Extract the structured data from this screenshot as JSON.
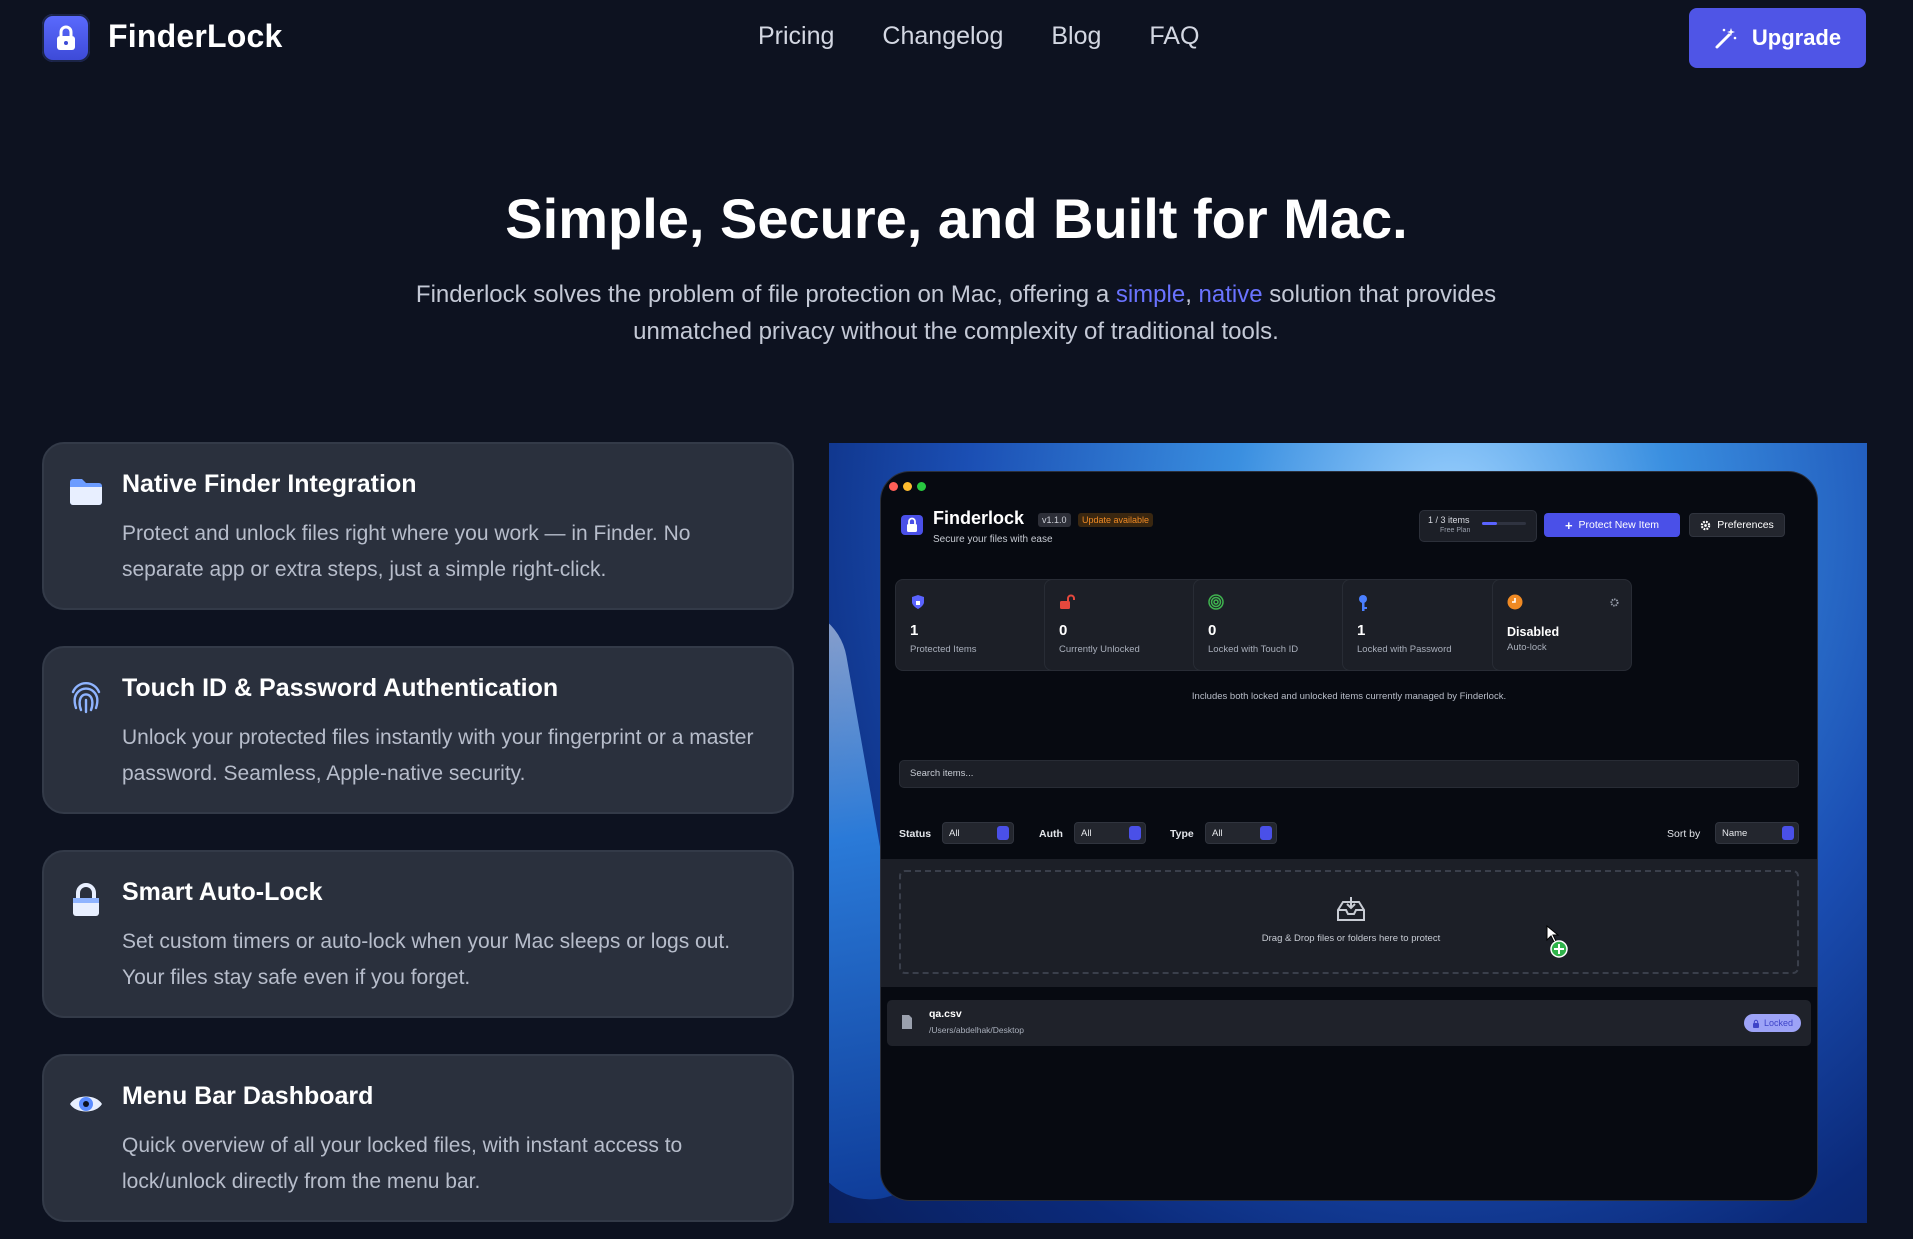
{
  "nav": {
    "brand": "FinderLock",
    "links": [
      "Pricing",
      "Changelog",
      "Blog",
      "FAQ"
    ],
    "upgrade_label": "Upgrade"
  },
  "hero": {
    "title": "Simple, Secure, and Built for Mac.",
    "subtitle_part1": "Finderlock solves the problem of file protection on Mac, offering a ",
    "highlight1": "simple",
    "comma": ", ",
    "highlight2": "native",
    "subtitle_part2": " solution that provides unmatched privacy without the complexity of traditional tools."
  },
  "features": [
    {
      "icon": "folder-icon",
      "title": "Native Finder Integration",
      "desc": "Protect and unlock files right where you work — in Finder. No separate app or extra steps, just a simple right-click."
    },
    {
      "icon": "fingerprint-icon",
      "title": "Touch ID & Password Authentication",
      "desc": "Unlock your protected files instantly with your fingerprint or a master password. Seamless, Apple-native security."
    },
    {
      "icon": "lock-icon",
      "title": "Smart Auto-Lock",
      "desc": "Set custom timers or auto-lock when your Mac sleeps or logs out. Your files stay safe even if you forget."
    },
    {
      "icon": "eye-icon",
      "title": "Menu Bar Dashboard",
      "desc": "Quick overview of all your locked files, with instant access to lock/unlock directly from the menu bar."
    }
  ],
  "app": {
    "title": "Finderlock",
    "version": "v1.1.0",
    "update": "Update available",
    "subtitle": "Secure your files with ease",
    "plan_items": "1 / 3 items",
    "plan_name": "Free Plan",
    "plan_usage": 0.33,
    "protect_label": "Protect New Item",
    "prefs_label": "Preferences",
    "stats": [
      {
        "value": "1",
        "label": "Protected Items",
        "icon": "shield-icon",
        "color": "#5a63ff"
      },
      {
        "value": "0",
        "label": "Currently Unlocked",
        "icon": "unlock-icon",
        "color": "#e5483d"
      },
      {
        "value": "0",
        "label": "Locked with Touch ID",
        "icon": "fingerprint-icon",
        "color": "#3fb34f"
      },
      {
        "value": "1",
        "label": "Locked with Password",
        "icon": "key-icon",
        "color": "#4a7fff"
      },
      {
        "value": "Disabled",
        "label": "Auto-lock",
        "icon": "clock-icon",
        "color": "#f08a24"
      }
    ],
    "stats_note": "Includes both locked and unlocked items currently managed by Finderlock.",
    "search_placeholder": "Search items...",
    "filters": {
      "status_label": "Status",
      "status_value": "All",
      "auth_label": "Auth",
      "auth_value": "All",
      "type_label": "Type",
      "type_value": "All",
      "sort_label": "Sort by",
      "sort_value": "Name"
    },
    "drop_text": "Drag & Drop files or folders here to protect",
    "item": {
      "name": "qa.csv",
      "path": "/Users/abdelhak/Desktop",
      "status": "Locked"
    }
  }
}
